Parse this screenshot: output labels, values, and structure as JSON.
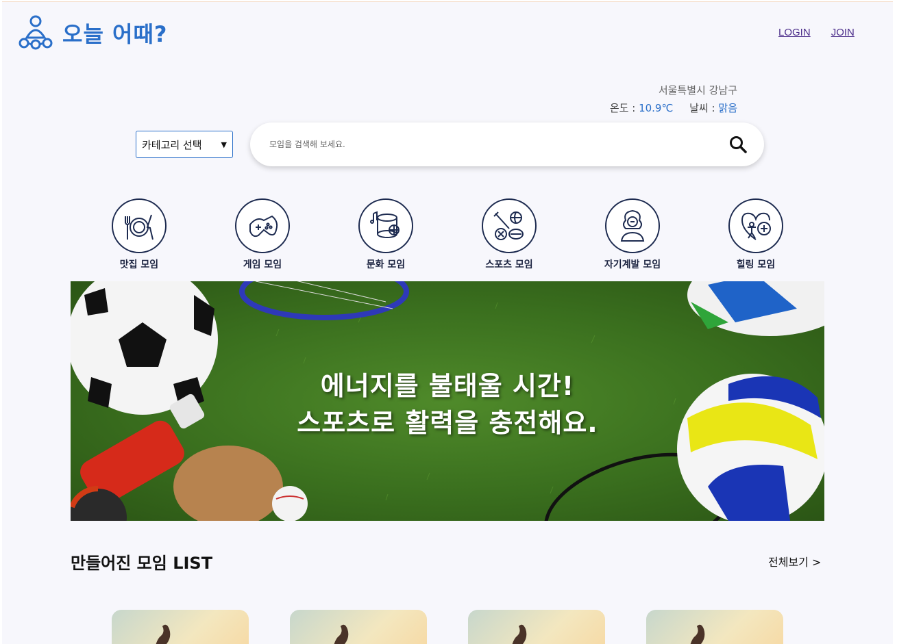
{
  "header": {
    "logo_text": "오늘 어때?",
    "login_label": "LOGIN",
    "join_label": "JOIN"
  },
  "weather": {
    "location": "서울특별시 강남구",
    "temp_label": "온도 :",
    "temp_value": "10.9℃",
    "weather_label": "날씨 :",
    "weather_value": "맑음"
  },
  "search": {
    "category_selected": "카테고리 선택",
    "placeholder": "모임을 검색해 보세요."
  },
  "categories": [
    {
      "label": "맛집 모임",
      "icon": "dining-icon"
    },
    {
      "label": "게임 모임",
      "icon": "gamepad-icon"
    },
    {
      "label": "문화 모임",
      "icon": "culture-icon"
    },
    {
      "label": "스포츠 모임",
      "icon": "sports-icon"
    },
    {
      "label": "자기계발 모임",
      "icon": "self-development-icon"
    },
    {
      "label": "힐링 모임",
      "icon": "healing-icon"
    }
  ],
  "banner": {
    "line1": "에너지를 불태울 시간!",
    "line2": "스포츠로 활력을 충전해요."
  },
  "list": {
    "title": "만들어진 모임 LIST",
    "see_all": "전체보기 >"
  },
  "colors": {
    "accent": "#2a6fc9",
    "icon_stroke": "#1d2b50"
  }
}
